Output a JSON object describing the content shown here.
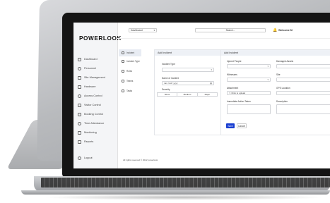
{
  "app": {
    "logo_text": "POWERLOOK"
  },
  "topbar": {
    "dashboard_select": "Dashboard",
    "search_placeholder": "Search...",
    "welcome_text": "Welcome M"
  },
  "sidebar": {
    "items": [
      {
        "label": "Dashboard",
        "icon": "grid-icon"
      },
      {
        "label": "Personnel",
        "icon": "person-icon"
      },
      {
        "label": "Site Management",
        "icon": "site-icon"
      },
      {
        "label": "Hardware",
        "icon": "hardware-icon"
      },
      {
        "label": "Access Control",
        "icon": "lock-icon"
      },
      {
        "label": "Visitor Control",
        "icon": "visitor-icon"
      },
      {
        "label": "Booking Control",
        "icon": "calendar-icon"
      },
      {
        "label": "Time Attendance",
        "icon": "clock-icon"
      },
      {
        "label": "Monitoring",
        "icon": "monitor-icon"
      },
      {
        "label": "Reports",
        "icon": "report-icon"
      },
      {
        "label": "Logout",
        "icon": "logout-icon"
      }
    ]
  },
  "subnav": {
    "items": [
      {
        "label": "Incident",
        "active": true
      },
      {
        "label": "Incident Type",
        "active": false
      },
      {
        "label": "Roles",
        "active": false
      },
      {
        "label": "Teams",
        "active": false
      },
      {
        "label": "Tasks",
        "active": false
      }
    ]
  },
  "add_incident": {
    "title": "Add Incident",
    "incident_type_label": "Incident Type",
    "name_label": "Name of Incident",
    "date_value": "mm / dd / yyyy",
    "severity_label": "Severity",
    "severity_options": [
      "Minor",
      "Medium",
      "Major"
    ]
  },
  "add_incident_right": {
    "title": "Add Incident",
    "injured_label": "Injured People",
    "damaged_label": "Damaged Assets",
    "witnesses_label": "Witnesses",
    "site_label": "Site",
    "attachment_label": "Attachment",
    "upload_label": "Click to upload",
    "gps_label": "GPS Location",
    "actions_label": "Immediate Action Taken",
    "description_label": "Description"
  },
  "buttons": {
    "save": "Save",
    "cancel": "Cancel"
  },
  "footer": {
    "text": "All rights reserved © 2022 powerlook"
  }
}
